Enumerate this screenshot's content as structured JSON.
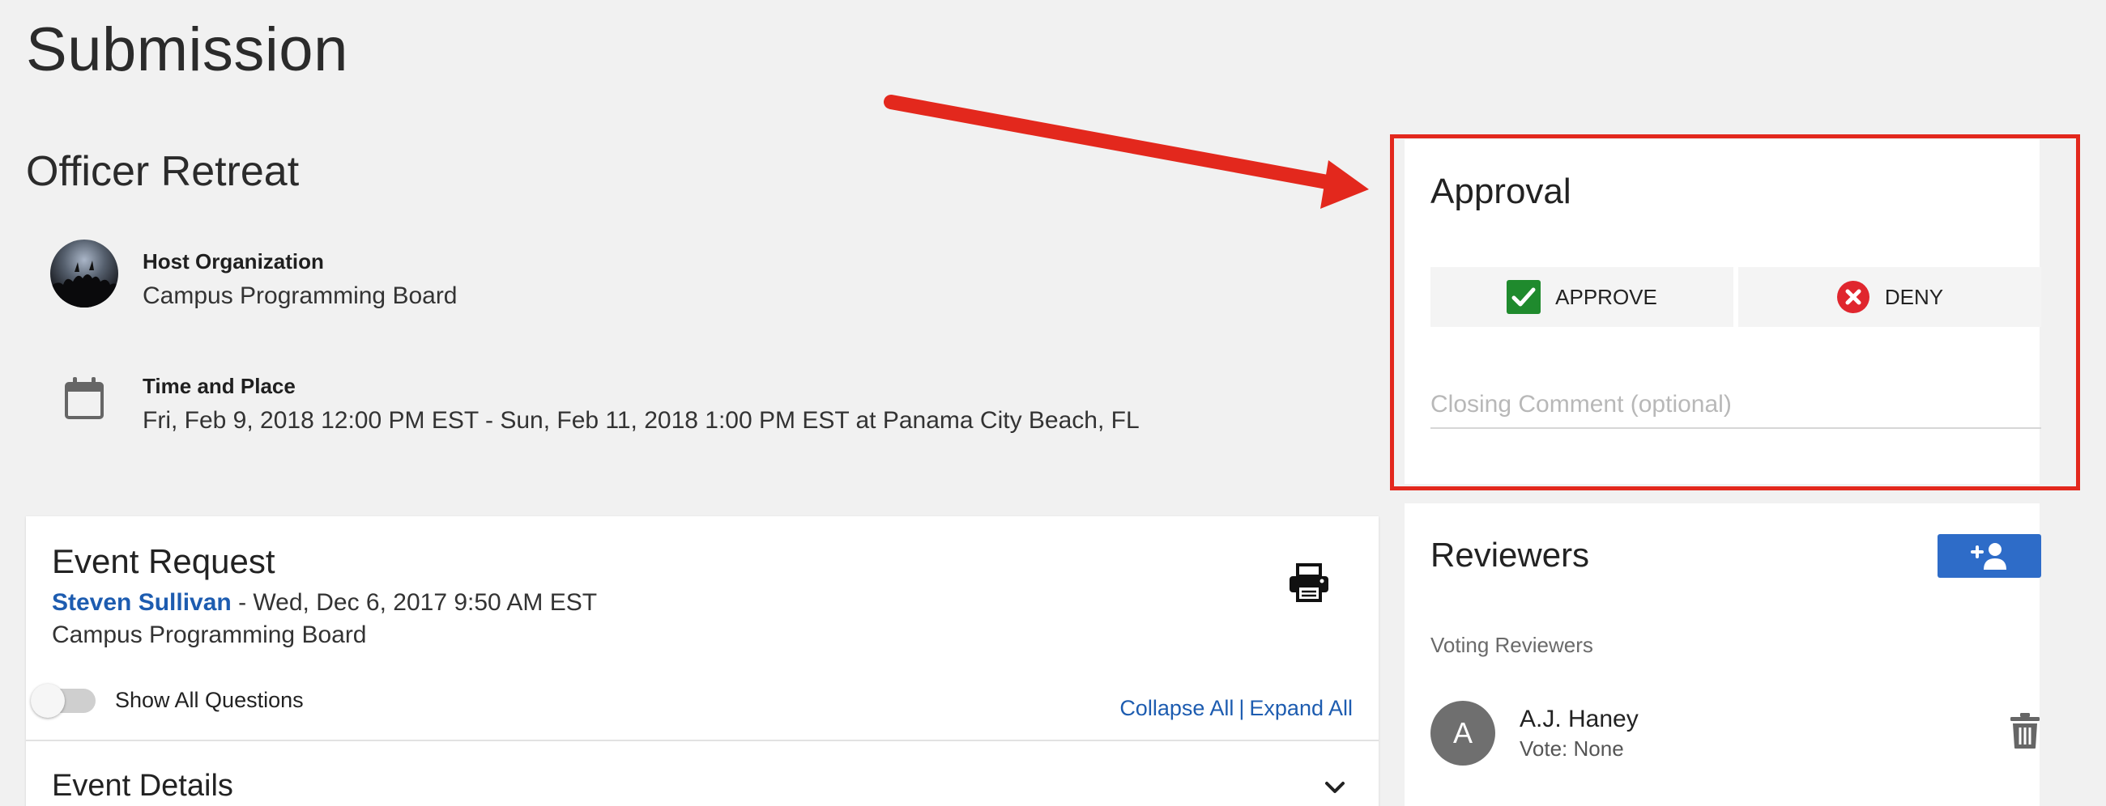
{
  "page": {
    "title": "Submission"
  },
  "event": {
    "title": "Officer Retreat",
    "host": {
      "label": "Host Organization",
      "value": "Campus Programming Board"
    },
    "time_place": {
      "label": "Time and Place",
      "value": "Fri, Feb 9, 2018 12:00 PM EST - Sun, Feb 11, 2018 1:00 PM EST at Panama City Beach, FL"
    }
  },
  "approval": {
    "title": "Approval",
    "approve_label": "APPROVE",
    "deny_label": "DENY",
    "comment_placeholder": "Closing Comment (optional)",
    "approve_color": "#1f8a2d",
    "deny_color": "#e0262e"
  },
  "request": {
    "title": "Event Request",
    "author": "Steven Sullivan",
    "submitted": " - Wed, Dec 6, 2017 9:50 AM EST",
    "organization": "Campus Programming Board",
    "toggle_label": "Show All Questions",
    "collapse_all": "Collapse All",
    "separator": "|",
    "expand_all": "Expand All",
    "section_title": "Event Details"
  },
  "reviewers": {
    "title": "Reviewers",
    "voting_label": "Voting Reviewers",
    "items": [
      {
        "initial": "A",
        "name": "A.J. Haney",
        "vote": "Vote: None"
      }
    ]
  },
  "annotation": {
    "highlight_color": "#e3281d"
  }
}
